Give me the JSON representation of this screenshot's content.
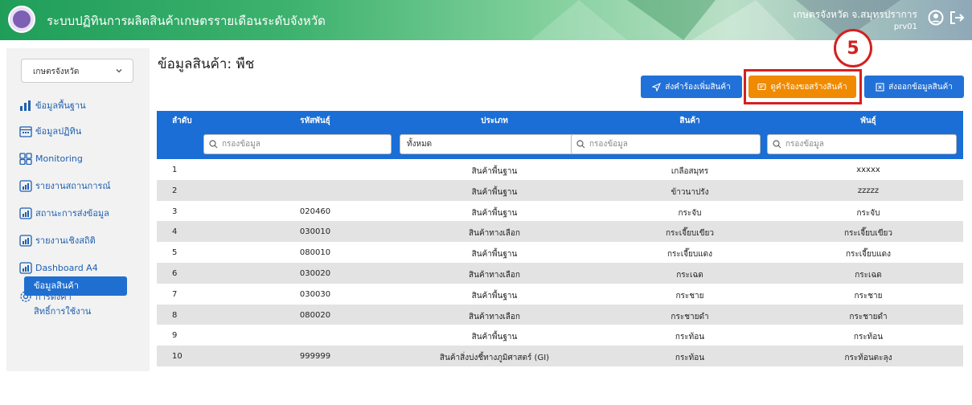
{
  "header": {
    "app_title": "ระบบปฏิทินการผลิตสินค้าเกษตรรายเดือนระดับจังหวัด",
    "user_org": "เกษตรจังหวัด จ.สมุทรปราการ",
    "user_code": "prv01"
  },
  "sidebar": {
    "role_select": "เกษตรจังหวัด",
    "items": [
      {
        "label": "ข้อมูลพื้นฐาน",
        "icon": "bar-chart-icon"
      },
      {
        "label": "ข้อมูลปฏิทิน",
        "icon": "calendar-icon"
      },
      {
        "label": "Monitoring",
        "icon": "grid-icon"
      },
      {
        "label": "รายงานสถานการณ์",
        "icon": "report-icon"
      },
      {
        "label": "สถานะการส่งข้อมูล",
        "icon": "report-icon"
      },
      {
        "label": "รายงานเชิงสถิติ",
        "icon": "report-icon"
      },
      {
        "label": "Dashboard A4",
        "icon": "report-icon"
      },
      {
        "label": "การตั้งค่า",
        "icon": "gear-icon"
      }
    ],
    "active_sub": "ข้อมูลสินค้า",
    "sub_item": "สิทธิ์การใช้งาน"
  },
  "main": {
    "page_title": "ข้อมูลสินค้า: พืช",
    "buttons": {
      "send_request": "ส่งคำร้องเพิ่มสินค้า",
      "view_requests": "ดูคำร้องขอสร้างสินค้า",
      "export": "ส่งออกข้อมูลสินค้า"
    },
    "step_badge": "5",
    "table": {
      "headers": [
        "ลำดับ",
        "รหัสพันธุ์",
        "ประเภท",
        "สินค้า",
        "พันธุ์"
      ],
      "filters": {
        "code_placeholder": "กรองข้อมูล",
        "type_selected": "ทั้งหมด",
        "product_placeholder": "กรองข้อมูล",
        "variety_placeholder": "กรองข้อมูล"
      },
      "rows": [
        [
          "1",
          "",
          "สินค้าพื้นฐาน",
          "เกลือสมุทร",
          "xxxxx"
        ],
        [
          "2",
          "",
          "สินค้าพื้นฐาน",
          "ข้าวนาปรัง",
          "zzzzz"
        ],
        [
          "3",
          "020460",
          "สินค้าพื้นฐาน",
          "กระจับ",
          "กระจับ"
        ],
        [
          "4",
          "030010",
          "สินค้าทางเลือก",
          "กระเจี๊ยบเขียว",
          "กระเจี๊ยบเขียว"
        ],
        [
          "5",
          "080010",
          "สินค้าพื้นฐาน",
          "กระเจี๊ยบแดง",
          "กระเจี๊ยบแดง"
        ],
        [
          "6",
          "030020",
          "สินค้าทางเลือก",
          "กระเฉด",
          "กระเฉด"
        ],
        [
          "7",
          "030030",
          "สินค้าพื้นฐาน",
          "กระชาย",
          "กระชาย"
        ],
        [
          "8",
          "080020",
          "สินค้าทางเลือก",
          "กระชายดำ",
          "กระชายดำ"
        ],
        [
          "9",
          "",
          "สินค้าพื้นฐาน",
          "กระท้อน",
          "กระท้อน"
        ],
        [
          "10",
          "999999",
          "สินค้าสิ่งบ่งชี้ทางภูมิศาสตร์ (GI)",
          "กระท้อน",
          "กระท้อนตะลุง"
        ]
      ]
    }
  },
  "colors": {
    "accent": "#1a6ed6",
    "highlight": "#f08a00",
    "annotation": "#d42020"
  }
}
